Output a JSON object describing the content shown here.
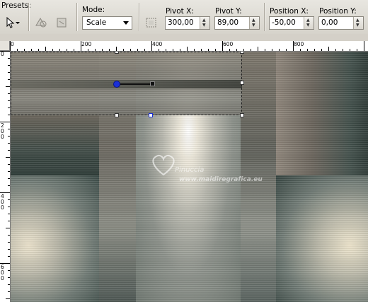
{
  "toolbar": {
    "presets_label": "Presets:",
    "mode_label": "Mode:",
    "mode_value": "Scale",
    "pivot_x_label": "Pivot X:",
    "pivot_x_value": "300,00",
    "pivot_y_label": "Pivot Y:",
    "pivot_y_value": "89,00",
    "position_x_label": "Position X:",
    "position_x_value": "-50,00",
    "position_y_label": "Position Y:",
    "position_y_value": "0,00"
  },
  "ruler": {
    "h_labels": [
      "0",
      "200",
      "400",
      "600",
      "800"
    ],
    "v_labels": [
      "0",
      "2\n0\n0",
      "4\n0\n0",
      "6\n0\n0"
    ]
  },
  "watermark": {
    "brand": "Pinuccia",
    "url": "www.maidiregrafica.eu"
  },
  "colors": {
    "pivot_handle": "#1a2fd8",
    "toolbar_bg": "#d4d0c8"
  }
}
